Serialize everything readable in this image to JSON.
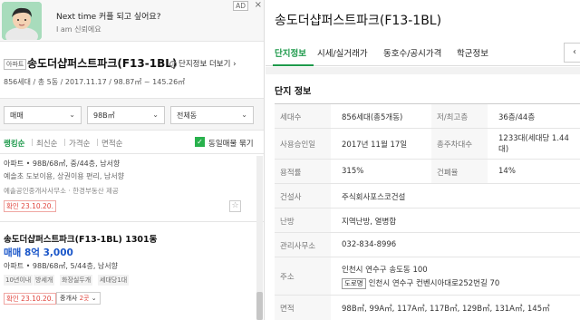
{
  "ad": {
    "title": "Next time 커플 되고 싶어요?",
    "subtitle": "I am 신뢰에요",
    "tag": "AD",
    "close": "×"
  },
  "complex": {
    "badge": "아파트",
    "name": "송도더샵퍼스트파크(F13-1BL)",
    "info_link": "단지정보 더보기",
    "meta": "856세대 / 총 5동 / 2017.11.17 / 98.87㎡ ~ 145.26㎡"
  },
  "filters": [
    {
      "value": "매매"
    },
    {
      "value": "98B㎡"
    },
    {
      "value": "전체동"
    }
  ],
  "sort": {
    "options": [
      "랭킹순",
      "최신순",
      "가격순",
      "면적순"
    ],
    "active": "랭킹순",
    "checkbox_label": "동일매물 묶기"
  },
  "listing1": {
    "type": "아파트 • 98B/68㎡, 중/44층, 남서향",
    "desc": "예솔초 도보이용, 상권이용 편리, 남서향",
    "agent": "예솔공인중개사사무소 · 한경부동산 제공",
    "confirm": "확인 23.10.20."
  },
  "listing2": {
    "title": "송도더샵퍼스트파크(F13-1BL) 1301동",
    "price": "매매 8억 3,000",
    "type": "아파트 • 98B/68㎡, 5/44층, 남서향",
    "tags": [
      "10년이내",
      "방세개",
      "화장실두개",
      "세대당1대"
    ],
    "confirm": "확인 23.10.20.",
    "agent_btn": "중개사",
    "agent_count": "2곳",
    "agent_chevron": "⌄"
  },
  "detail": {
    "title": "송도더샵퍼스트파크(F13-1BL)",
    "tabs": [
      "단지정보",
      "시세/실거래가",
      "동호수/공시가격",
      "학군정보"
    ],
    "active_tab": "단지정보",
    "tab_nav": "‹",
    "section_title": "단지 정보",
    "rows": {
      "households_label": "세대수",
      "households": "856세대(총5개동)",
      "floors_label": "저/최고층",
      "floors": "36층/44층",
      "approval_label": "사용승인일",
      "approval": "2017년 11월 17일",
      "parking_label": "총주차대수",
      "parking": "1233대(세대당 1.44대)",
      "far_label": "용적률",
      "far": "315%",
      "bcr_label": "건폐율",
      "bcr": "14%",
      "builder_label": "건설사",
      "builder": "주식회사포스코건설",
      "heating_label": "난방",
      "heating": "지역난방, 열병합",
      "office_label": "관리사무소",
      "office": "032-834-8996",
      "address_label": "주소",
      "address": "인천시 연수구 송도동 100",
      "road_tag": "도로명",
      "road_address": "인천시 연수구 컨벤시아대로252번길 70",
      "area_label": "면적",
      "area": "98B㎡, 99A㎡, 117A㎡, 117B㎡, 129B㎡, 131A㎡, 145㎡"
    }
  },
  "colors": {
    "accent": "#1f9a4c",
    "price": "#1a56c9",
    "alert": "#e0453e"
  }
}
